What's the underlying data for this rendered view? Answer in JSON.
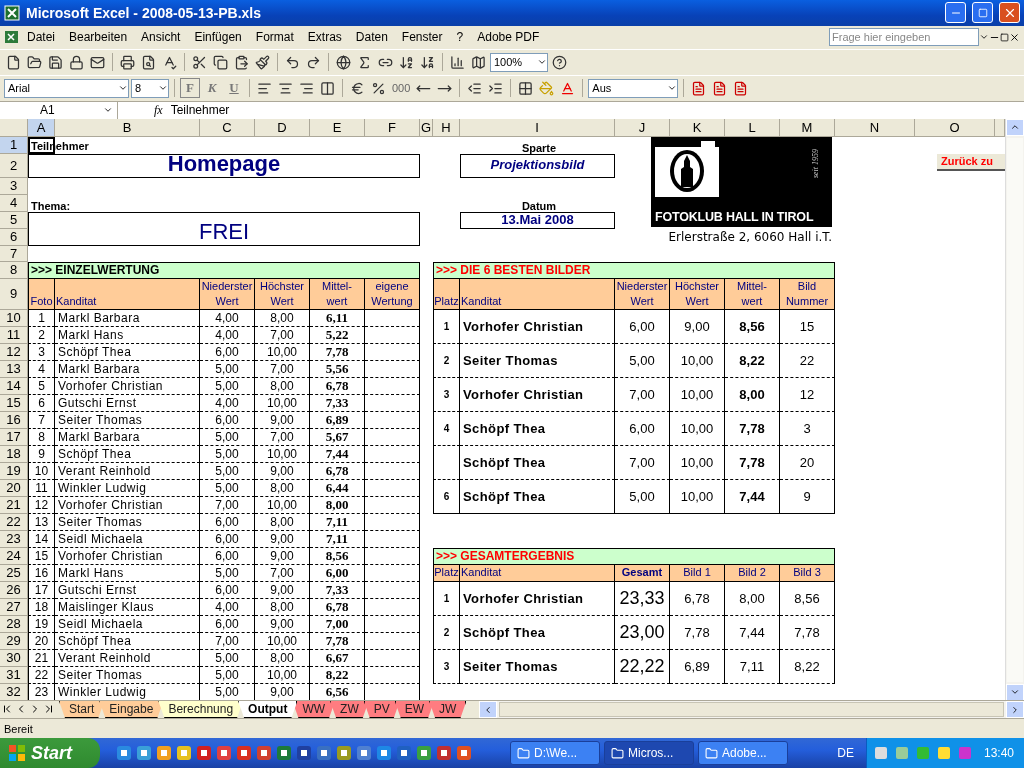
{
  "window": {
    "title": "Microsoft Excel - 2008-05-13-PB.xls"
  },
  "menu": [
    "Datei",
    "Bearbeiten",
    "Ansicht",
    "Einfügen",
    "Format",
    "Extras",
    "Daten",
    "Fenster",
    "?",
    "Adobe PDF"
  ],
  "help_search": {
    "placeholder": "Frage hier eingeben"
  },
  "toolbar": {
    "zoom": "100%",
    "font": "Arial",
    "font_size": "8",
    "bold": "F",
    "italic": "K",
    "underline": "U",
    "thousands": "000",
    "border_mode": "Aus"
  },
  "formula_bar": {
    "cell": "A1",
    "fx": "fx",
    "value": "Teilnehmer"
  },
  "columns": [
    {
      "label": "A",
      "selected": true
    },
    {
      "label": "B",
      "selected": false
    },
    {
      "label": "C",
      "selected": false
    },
    {
      "label": "D",
      "selected": false
    },
    {
      "label": "E",
      "selected": false
    },
    {
      "label": "F",
      "selected": false
    },
    {
      "label": "G",
      "selected": false
    },
    {
      "label": "H",
      "selected": false
    },
    {
      "label": "I",
      "selected": false
    },
    {
      "label": "J",
      "selected": false
    },
    {
      "label": "K",
      "selected": false
    },
    {
      "label": "L",
      "selected": false
    },
    {
      "label": "M",
      "selected": false
    },
    {
      "label": "N",
      "selected": false
    },
    {
      "label": "O",
      "selected": false
    }
  ],
  "rows": [
    {
      "label": "1",
      "selected": true
    },
    {
      "label": "2",
      "selected": false
    },
    {
      "label": "3",
      "selected": false
    },
    {
      "label": "4",
      "selected": false
    },
    {
      "label": "5",
      "selected": false
    },
    {
      "label": "6",
      "selected": false
    },
    {
      "label": "7",
      "selected": false
    },
    {
      "label": "8",
      "selected": false
    },
    {
      "label": "9",
      "selected": false
    },
    {
      "label": "10",
      "selected": false
    },
    {
      "label": "11",
      "selected": false
    },
    {
      "label": "12",
      "selected": false
    },
    {
      "label": "13",
      "selected": false
    },
    {
      "label": "14",
      "selected": false
    },
    {
      "label": "15",
      "selected": false
    },
    {
      "label": "16",
      "selected": false
    },
    {
      "label": "17",
      "selected": false
    },
    {
      "label": "18",
      "selected": false
    },
    {
      "label": "19",
      "selected": false
    },
    {
      "label": "20",
      "selected": false
    },
    {
      "label": "21",
      "selected": false
    },
    {
      "label": "22",
      "selected": false
    },
    {
      "label": "23",
      "selected": false
    },
    {
      "label": "24",
      "selected": false
    },
    {
      "label": "25",
      "selected": false
    },
    {
      "label": "26",
      "selected": false
    },
    {
      "label": "27",
      "selected": false
    },
    {
      "label": "28",
      "selected": false
    },
    {
      "label": "29",
      "selected": false
    },
    {
      "label": "30",
      "selected": false
    },
    {
      "label": "31",
      "selected": false
    },
    {
      "label": "32",
      "selected": false
    }
  ],
  "header": {
    "teilnehmer_label": "Teilnehmer",
    "teilnehmer": "Homepage",
    "thema_label": "Thema:",
    "thema": "FREI",
    "sparte_label": "Sparte",
    "sparte": "Projektionsbild",
    "datum_label": "Datum",
    "datum": "13.Mai 2008",
    "logo_text": "FOTOKLUB HALL IN TIROL",
    "logo_since": "seit 1959",
    "address": "Erlerstraße 2, 6060 Hall i.T.",
    "back_button": "Zurück zu"
  },
  "einzelwertung": {
    "title": ">>> EINZELWERTUNG",
    "columns": [
      "Foto",
      "Kanditat",
      "Niederster Wert",
      "Höchster Wert",
      "Mittel-wert",
      "eigene Wertung"
    ],
    "rows": [
      [
        "1",
        "Markl Barbara",
        "4,00",
        "8,00",
        "6,11"
      ],
      [
        "2",
        "Markl Hans",
        "4,00",
        "7,00",
        "5,22"
      ],
      [
        "3",
        "Schöpf Thea",
        "6,00",
        "10,00",
        "7,78"
      ],
      [
        "4",
        "Markl Barbara",
        "5,00",
        "7,00",
        "5,56"
      ],
      [
        "5",
        "Vorhofer Christian",
        "5,00",
        "8,00",
        "6,78"
      ],
      [
        "6",
        "Gutschi Ernst",
        "4,00",
        "10,00",
        "7,33"
      ],
      [
        "7",
        "Seiter Thomas",
        "6,00",
        "9,00",
        "6,89"
      ],
      [
        "8",
        "Markl Barbara",
        "5,00",
        "7,00",
        "5,67"
      ],
      [
        "9",
        "Schöpf Thea",
        "5,00",
        "10,00",
        "7,44"
      ],
      [
        "10",
        "Verant Reinhold",
        "5,00",
        "9,00",
        "6,78"
      ],
      [
        "11",
        "Winkler Ludwig",
        "5,00",
        "8,00",
        "6,44"
      ],
      [
        "12",
        "Vorhofer Christian",
        "7,00",
        "10,00",
        "8,00"
      ],
      [
        "13",
        "Seiter Thomas",
        "6,00",
        "8,00",
        "7,11"
      ],
      [
        "14",
        "Seidl Michaela",
        "6,00",
        "9,00",
        "7,11"
      ],
      [
        "15",
        "Vorhofer Christian",
        "6,00",
        "9,00",
        "8,56"
      ],
      [
        "16",
        "Markl Hans",
        "5,00",
        "7,00",
        "6,00"
      ],
      [
        "17",
        "Gutschi Ernst",
        "6,00",
        "9,00",
        "7,33"
      ],
      [
        "18",
        "Maislinger Klaus",
        "4,00",
        "8,00",
        "6,78"
      ],
      [
        "19",
        "Seidl Michaela",
        "6,00",
        "9,00",
        "7,00"
      ],
      [
        "20",
        "Schöpf Thea",
        "7,00",
        "10,00",
        "7,78"
      ],
      [
        "21",
        "Verant Reinhold",
        "5,00",
        "8,00",
        "6,67"
      ],
      [
        "22",
        "Seiter Thomas",
        "5,00",
        "10,00",
        "8,22"
      ],
      [
        "23",
        "Winkler Ludwig",
        "5,00",
        "9,00",
        "6,56"
      ]
    ]
  },
  "besten": {
    "title": ">>> DIE 6 BESTEN BILDER",
    "columns": [
      "Platz",
      "Kanditat",
      "Niederster Wert",
      "Höchster Wert",
      "Mittel-wert",
      "Bild Nummer"
    ],
    "rows": [
      [
        "1",
        "Vorhofer Christian",
        "6,00",
        "9,00",
        "8,56",
        "15"
      ],
      [
        "2",
        "Seiter Thomas",
        "5,00",
        "10,00",
        "8,22",
        "22"
      ],
      [
        "3",
        "Vorhofer Christian",
        "7,00",
        "10,00",
        "8,00",
        "12"
      ],
      [
        "4",
        "Schöpf Thea",
        "6,00",
        "10,00",
        "7,78",
        "3"
      ],
      [
        "",
        "Schöpf Thea",
        "7,00",
        "10,00",
        "7,78",
        "20"
      ],
      [
        "6",
        "Schöpf Thea",
        "5,00",
        "10,00",
        "7,44",
        "9"
      ]
    ]
  },
  "gesamt": {
    "title": ">>> GESAMTERGEBNIS",
    "columns": [
      "Platz",
      "Kanditat",
      "Gesamt",
      "Bild 1",
      "Bild 2",
      "Bild 3"
    ],
    "rows": [
      [
        "1",
        "Vorhofer Christian",
        "23,33",
        "6,78",
        "8,00",
        "8,56"
      ],
      [
        "2",
        "Schöpf Thea",
        "23,00",
        "7,78",
        "7,44",
        "7,78"
      ],
      [
        "3",
        "Seiter Thomas",
        "22,22",
        "6,89",
        "7,11",
        "8,22"
      ]
    ]
  },
  "sheet_tabs": [
    {
      "label": "Start",
      "color": "#ffcc99",
      "selected": false
    },
    {
      "label": "Eingabe",
      "color": "#ffcc99",
      "selected": false
    },
    {
      "label": "Berechnung",
      "color": "#ffffcc",
      "selected": false
    },
    {
      "label": "Output",
      "color": "#ffffff",
      "selected": true
    },
    {
      "label": "WW",
      "color": "#ff7c80",
      "selected": false
    },
    {
      "label": "ZW",
      "color": "#ff7c80",
      "selected": false
    },
    {
      "label": "PV",
      "color": "#ff7c80",
      "selected": false
    },
    {
      "label": "EW",
      "color": "#ff7c80",
      "selected": false
    },
    {
      "label": "JW",
      "color": "#ff7c80",
      "selected": false
    }
  ],
  "status_bar": {
    "text": "Bereit"
  },
  "taskbar": {
    "start": "Start",
    "tasks": [
      {
        "label": "D:\\We...",
        "selected": false
      },
      {
        "label": "Micros...",
        "selected": true
      },
      {
        "label": "Adobe...",
        "selected": false
      }
    ],
    "language": "DE",
    "clock": "13:40"
  }
}
